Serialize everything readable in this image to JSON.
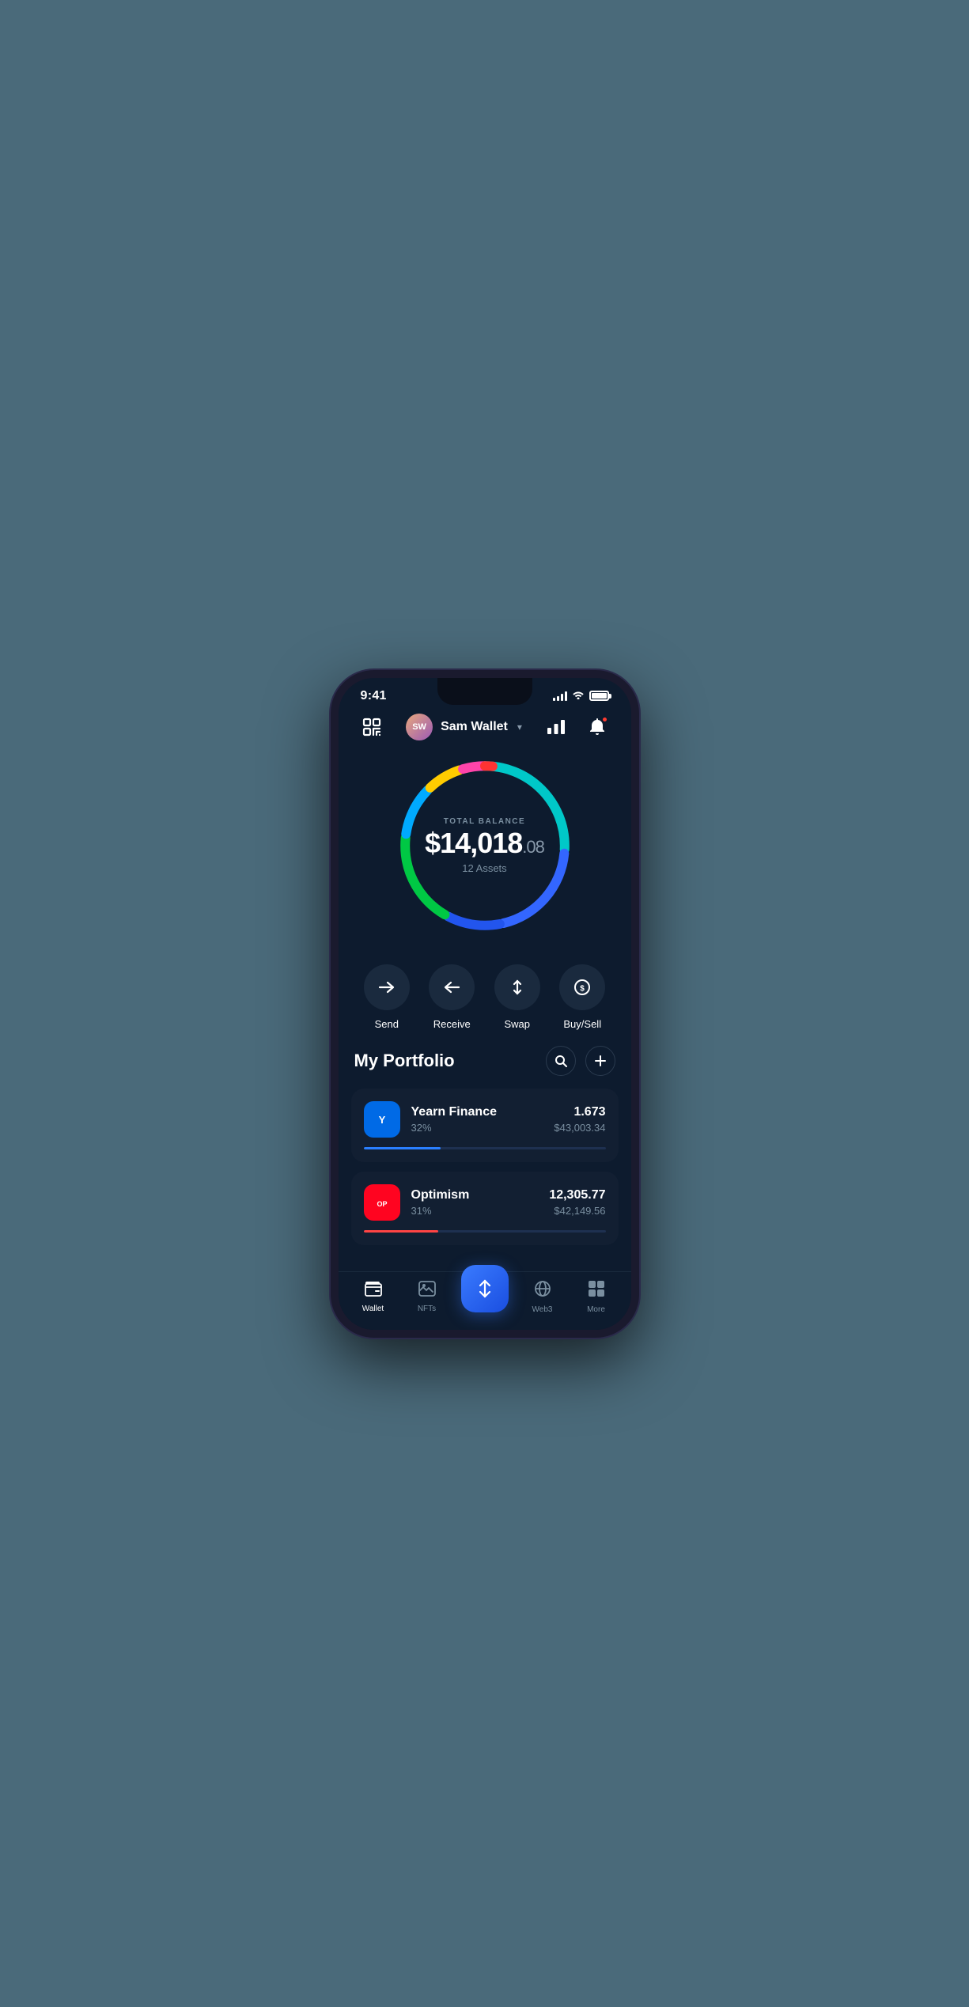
{
  "status": {
    "time": "9:41",
    "signal_bars": 4,
    "wifi": true,
    "battery_full": true
  },
  "header": {
    "scan_label": "scan",
    "wallet_name": "Sam Wallet",
    "wallet_initials": "SW",
    "chevron": "▾",
    "chart_label": "chart",
    "bell_label": "notifications"
  },
  "balance": {
    "label": "TOTAL BALANCE",
    "amount": "$14,018",
    "cents": ".08",
    "assets_count": "12 Assets"
  },
  "actions": [
    {
      "id": "send",
      "label": "Send",
      "icon": "→"
    },
    {
      "id": "receive",
      "label": "Receive",
      "icon": "←"
    },
    {
      "id": "swap",
      "label": "Swap",
      "icon": "⇅"
    },
    {
      "id": "buysell",
      "label": "Buy/Sell",
      "icon": "⊙"
    }
  ],
  "portfolio": {
    "title": "My Portfolio",
    "search_label": "search",
    "add_label": "add",
    "assets": [
      {
        "id": "yearn",
        "name": "Yearn Finance",
        "percent": "32%",
        "amount": "1.673",
        "usd": "$43,003.34",
        "progress": 32,
        "color": "#2a7fff",
        "initials": "Y"
      },
      {
        "id": "optimism",
        "name": "Optimism",
        "percent": "31%",
        "amount": "12,305.77",
        "usd": "$42,149.56",
        "progress": 31,
        "color": "#ff0420",
        "initials": "OP"
      }
    ]
  },
  "nav": {
    "items": [
      {
        "id": "wallet",
        "label": "Wallet",
        "active": true,
        "icon": "wallet"
      },
      {
        "id": "nfts",
        "label": "NFTs",
        "active": false,
        "icon": "nfts"
      },
      {
        "id": "center",
        "label": "",
        "active": false,
        "icon": "swap"
      },
      {
        "id": "web3",
        "label": "Web3",
        "active": false,
        "icon": "web3"
      },
      {
        "id": "more",
        "label": "More",
        "active": false,
        "icon": "more"
      }
    ]
  }
}
